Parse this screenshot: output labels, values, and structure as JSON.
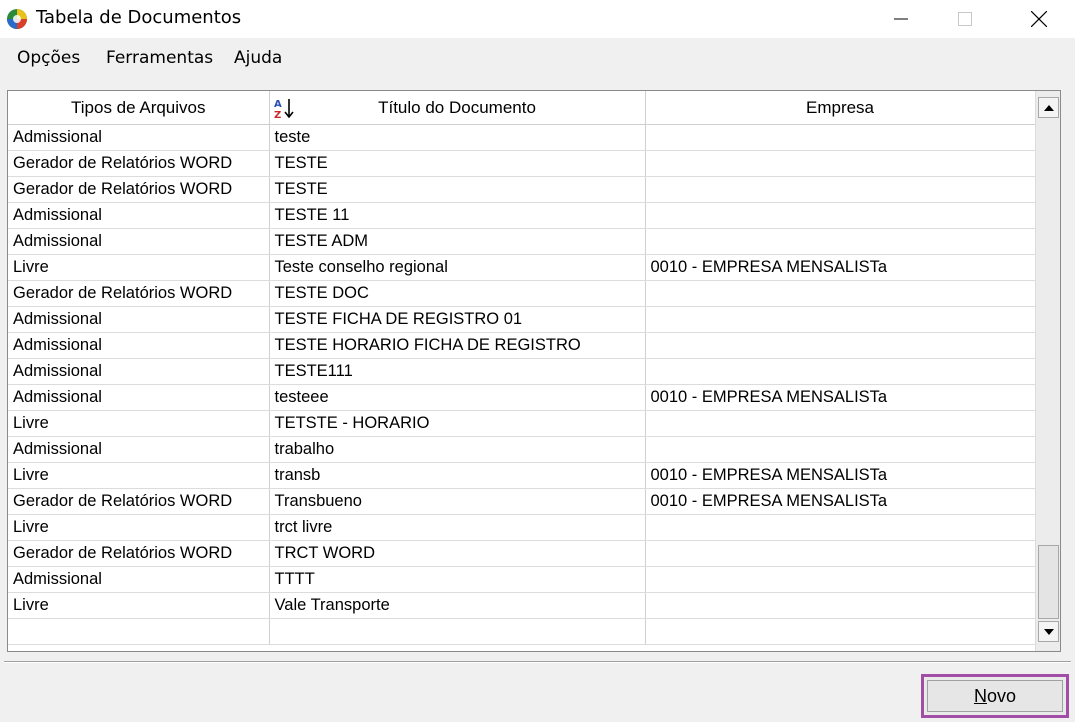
{
  "window": {
    "title": "Tabela de Documentos"
  },
  "menu": {
    "items": [
      "Opções",
      "Ferramentas",
      "Ajuda"
    ]
  },
  "grid": {
    "columns": [
      "Tipos de Arquivos",
      "Título do Documento",
      "Empresa"
    ],
    "rows": [
      [
        "Admissional",
        "teste",
        ""
      ],
      [
        "Gerador de Relatórios WORD",
        "TESTE",
        ""
      ],
      [
        "Gerador de Relatórios WORD",
        "TESTE",
        ""
      ],
      [
        "Admissional",
        "TESTE 11",
        ""
      ],
      [
        "Admissional",
        "TESTE ADM",
        ""
      ],
      [
        "Livre",
        "Teste conselho regional",
        "0010 - EMPRESA MENSALISTa"
      ],
      [
        "Gerador de Relatórios WORD",
        "TESTE DOC",
        ""
      ],
      [
        "Admissional",
        "TESTE FICHA DE REGISTRO 01",
        ""
      ],
      [
        "Admissional",
        "TESTE HORARIO FICHA DE REGISTRO",
        ""
      ],
      [
        "Admissional",
        "TESTE111",
        ""
      ],
      [
        "Admissional",
        "testeee",
        "0010 - EMPRESA MENSALISTa"
      ],
      [
        "Livre",
        "TETSTE - HORARIO",
        ""
      ],
      [
        "Admissional",
        "trabalho",
        ""
      ],
      [
        "Livre",
        "transb",
        "0010 - EMPRESA MENSALISTa"
      ],
      [
        "Gerador de Relatórios WORD",
        "Transbueno",
        "0010 - EMPRESA MENSALISTa"
      ],
      [
        "Livre",
        "trct livre",
        ""
      ],
      [
        "Gerador de Relatórios WORD",
        "TRCT WORD",
        ""
      ],
      [
        "Admissional",
        "TTTT",
        ""
      ],
      [
        "Livre",
        "Vale Transporte",
        ""
      ],
      [
        "",
        "",
        ""
      ]
    ]
  },
  "buttons": {
    "new_mnemonic": "N",
    "new_rest": "ovo"
  },
  "colors": {
    "highlight_border": "#a24ea6"
  }
}
